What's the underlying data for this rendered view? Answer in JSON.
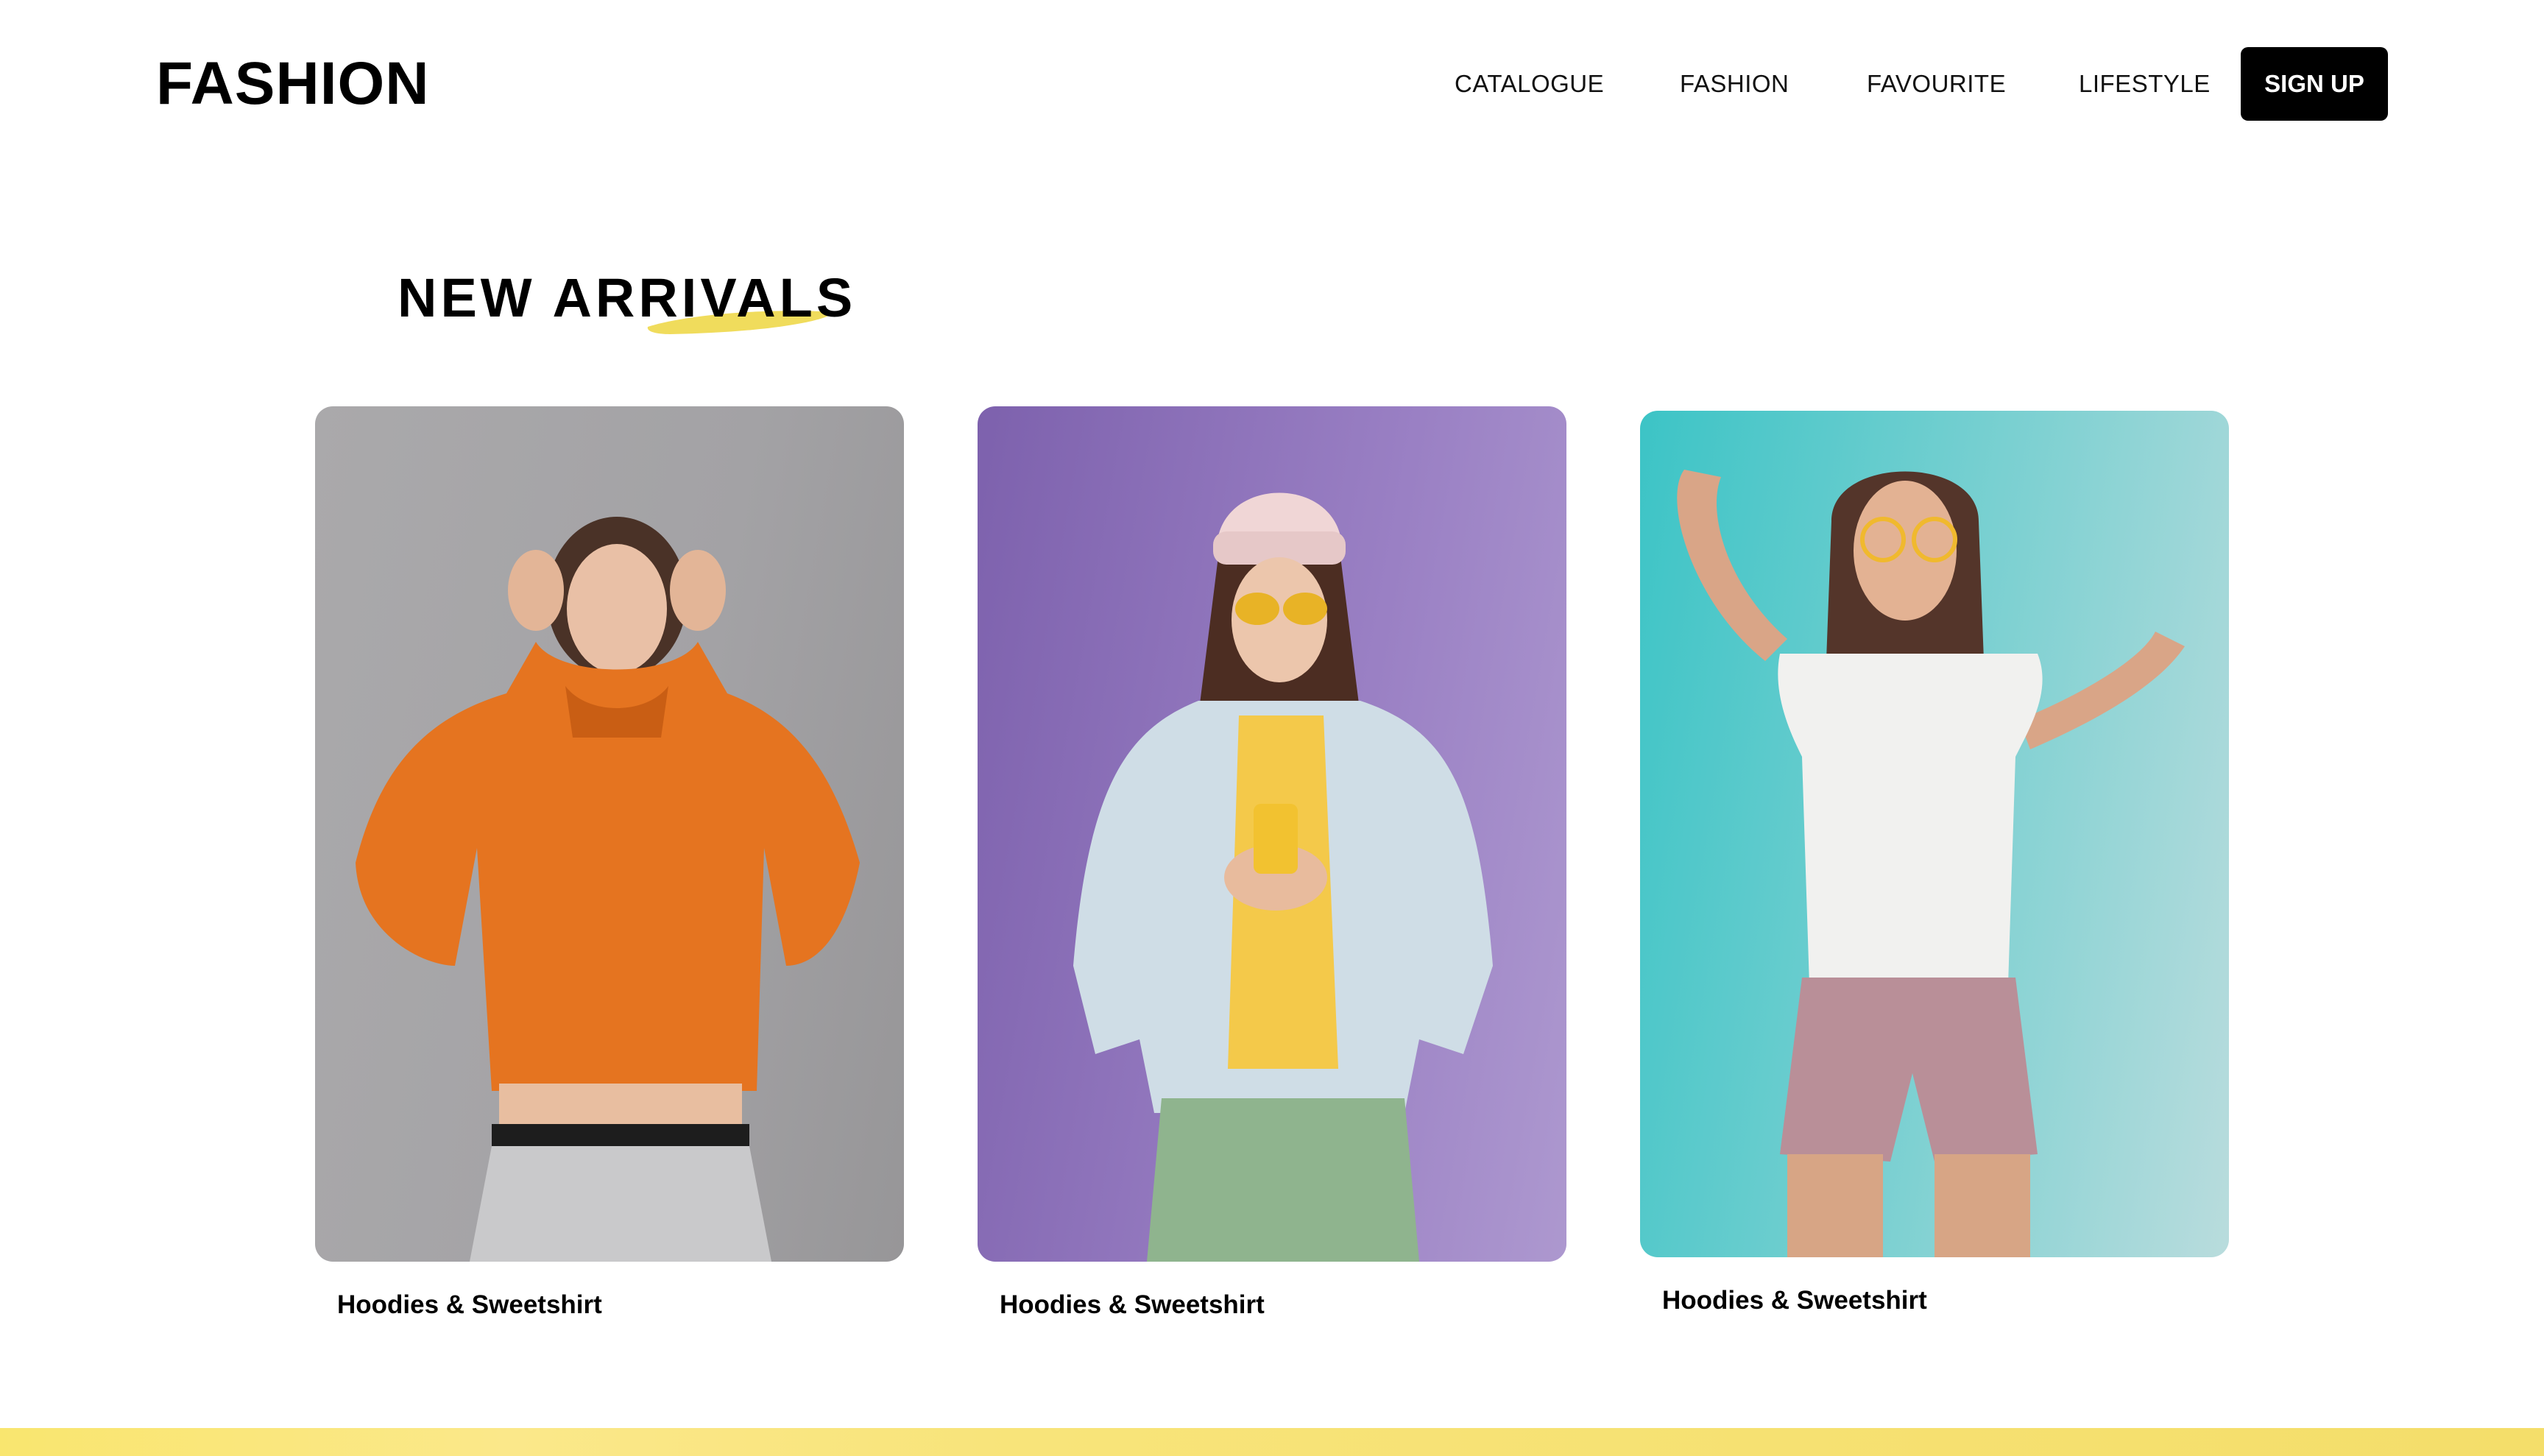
{
  "header": {
    "logo": "FASHION",
    "nav": [
      "CATALOGUE",
      "FASHION",
      "FAVOURITE",
      "LIFESTYLE"
    ],
    "signup_label": "SIGN UP"
  },
  "main": {
    "section_title": "NEW ARRIVALS",
    "products": [
      {
        "label": "Hoodies & Sweetshirt"
      },
      {
        "label": "Hoodies & Sweetshirt"
      },
      {
        "label": "Hoodies & Sweetshirt"
      }
    ]
  },
  "colors": {
    "accent": "#f0dc5c",
    "button_bg": "#000000",
    "card1_bg": "#a3a2a5",
    "card2_bg": "#9a80c4",
    "card3_bg": "#7fd1d2"
  }
}
